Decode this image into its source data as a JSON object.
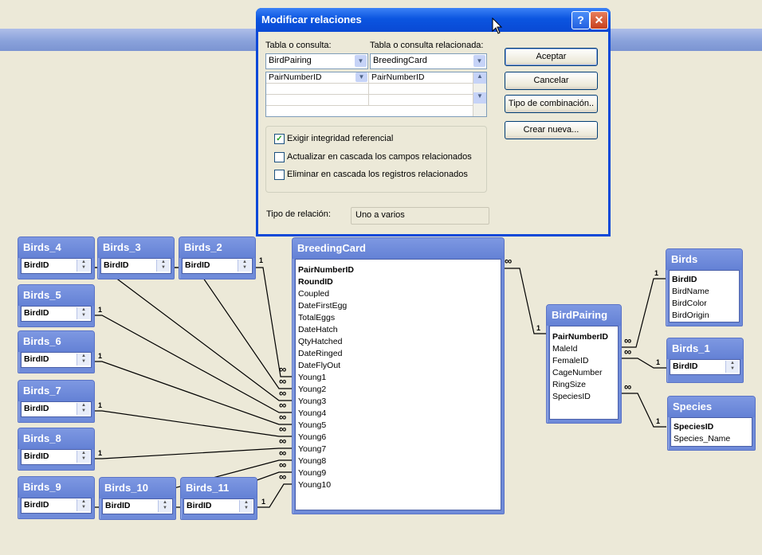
{
  "dialog": {
    "title": "Modificar relaciones",
    "help_glyph": "?",
    "close_glyph": "✕",
    "table_label": "Tabla o consulta:",
    "related_label": "Tabla o consulta relacionada:",
    "table_value": "BirdPairing",
    "related_value": "BreedingCard",
    "field_left": "PairNumberID",
    "field_right": "PairNumberID",
    "buttons": {
      "ok": "Aceptar",
      "cancel": "Cancelar",
      "join": "Tipo de combinación..",
      "new": "Crear nueva..."
    },
    "checks": [
      {
        "label": "Exigir integridad referencial",
        "checked": true
      },
      {
        "label": "Actualizar en cascada los campos relacionados",
        "checked": false
      },
      {
        "label": "Eliminar en cascada los registros relacionados",
        "checked": false
      }
    ],
    "rel_type_label": "Tipo de relación:",
    "rel_type_value": "Uno a varios"
  },
  "tables": {
    "birds_4": {
      "title": "Birds_4",
      "field": "BirdID"
    },
    "birds_3": {
      "title": "Birds_3",
      "field": "BirdID"
    },
    "birds_2": {
      "title": "Birds_2",
      "field": "BirdID"
    },
    "birds_5": {
      "title": "Birds_5",
      "field": "BirdID"
    },
    "birds_6": {
      "title": "Birds_6",
      "field": "BirdID"
    },
    "birds_7": {
      "title": "Birds_7",
      "field": "BirdID"
    },
    "birds_8": {
      "title": "Birds_8",
      "field": "BirdID"
    },
    "birds_9": {
      "title": "Birds_9",
      "field": "BirdID"
    },
    "birds_10": {
      "title": "Birds_10",
      "field": "BirdID"
    },
    "birds_11": {
      "title": "Birds_11",
      "field": "BirdID"
    },
    "birds_1": {
      "title": "Birds_1",
      "field": "BirdID"
    },
    "breedingcard": {
      "title": "BreedingCard",
      "fields": [
        "PairNumberID",
        "RoundID",
        "Coupled",
        "DateFirstEgg",
        "TotalEggs",
        "DateHatch",
        "QtyHatched",
        "DateRinged",
        "DateFlyOut",
        "Young1",
        "Young2",
        "Young3",
        "Young4",
        "Young5",
        "Young6",
        "Young7",
        "Young8",
        "Young9",
        "Young10"
      ]
    },
    "birdpairing": {
      "title": "BirdPairing",
      "fields": [
        "PairNumberID",
        "MaleId",
        "FemaleID",
        "CageNumber",
        "RingSize",
        "SpeciesID"
      ]
    },
    "birds": {
      "title": "Birds",
      "fields": [
        "BirdID",
        "BirdName",
        "BirdColor",
        "BirdOrigin"
      ]
    },
    "species": {
      "title": "Species",
      "fields": [
        "SpeciesID",
        "Species_Name"
      ]
    }
  },
  "cardinality": {
    "one": "1",
    "many": "∞"
  },
  "colors": {
    "title_bar": "#0a48d8",
    "table_header": "#6f8bd9",
    "canvas": "#ece9d8"
  }
}
